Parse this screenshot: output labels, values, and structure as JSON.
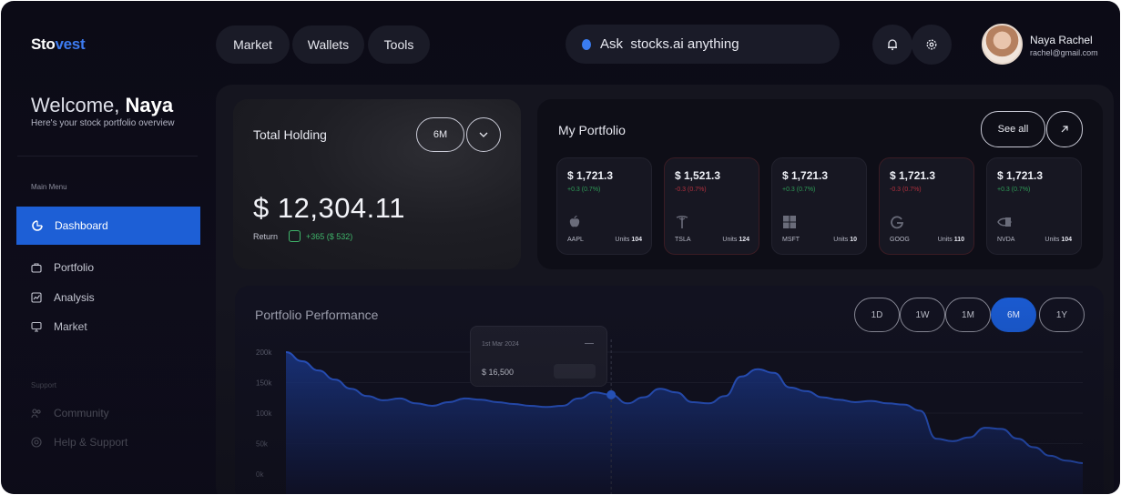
{
  "brand": {
    "name_part1": "Sto",
    "name_part2": "vest"
  },
  "nav": {
    "items": [
      "Market",
      "Wallets",
      "Tools"
    ]
  },
  "search": {
    "placeholder": "Ask  stocks.ai anything"
  },
  "header_icons": [
    "bell-icon",
    "gear-icon"
  ],
  "user": {
    "name": "Naya Rachel",
    "email": "rachel@gmail.com"
  },
  "sidebar": {
    "welcome_prefix": "Welcome, ",
    "welcome_name": "Naya",
    "subtitle": "Here's your stock portfolio overview",
    "main_menu_label": "Main Menu",
    "menu": [
      {
        "label": "Dashboard",
        "icon": "dashboard-icon",
        "active": true
      },
      {
        "label": "Portfolio",
        "icon": "portfolio-icon",
        "active": false
      },
      {
        "label": "Analysis",
        "icon": "analysis-icon",
        "active": false
      },
      {
        "label": "Market",
        "icon": "market-icon",
        "active": false
      }
    ],
    "support_label": "Support",
    "support": [
      {
        "label": "Community",
        "icon": "community-icon"
      },
      {
        "label": "Help & Support",
        "icon": "help-icon"
      }
    ]
  },
  "holding": {
    "title": "Total Holding",
    "period": "6M",
    "value": "$ 12,304.11",
    "return_label": "Return",
    "return_value": "+365 ($ 532)"
  },
  "portfolio": {
    "title": "My Portfolio",
    "see_all": "See all",
    "stocks": [
      {
        "price": "$ 1,721.3",
        "change": "+0.3 (0.7%)",
        "direction": "up",
        "symbol": "AAPL",
        "units_label": "Units",
        "units": "104",
        "icon": "apple-icon"
      },
      {
        "price": "$ 1,521.3",
        "change": "-0.3 (0.7%)",
        "direction": "down",
        "symbol": "TSLA",
        "units_label": "Units",
        "units": "124",
        "icon": "tesla-icon"
      },
      {
        "price": "$ 1,721.3",
        "change": "+0.3 (0.7%)",
        "direction": "up",
        "symbol": "MSFT",
        "units_label": "Units",
        "units": "10",
        "icon": "microsoft-icon"
      },
      {
        "price": "$ 1,721.3",
        "change": "-0.3 (0.7%)",
        "direction": "down",
        "symbol": "GOOG",
        "units_label": "Units",
        "units": "110",
        "icon": "google-icon"
      },
      {
        "price": "$ 1,721.3",
        "change": "+0.3 (0.7%)",
        "direction": "up",
        "symbol": "NVDA",
        "units_label": "Units",
        "units": "104",
        "icon": "nvidia-icon"
      }
    ],
    "colors": {
      "up": "#2e9c57",
      "down": "#b3303e"
    }
  },
  "performance": {
    "title": "Portfolio Performance",
    "ranges": [
      "1D",
      "1W",
      "1M",
      "6M",
      "1Y"
    ],
    "active_range": "6M",
    "tooltip": {
      "date": "1st Mar 2024",
      "value": "$ 16,500"
    },
    "accent": "#1a5ad0"
  },
  "chart_data": {
    "type": "area",
    "y_ticks": [
      "200k",
      "150k",
      "100k",
      "50k",
      "0k"
    ],
    "ylim": [
      0,
      200000
    ],
    "values": [
      200000,
      185000,
      170000,
      155000,
      140000,
      128000,
      121000,
      124000,
      116000,
      112000,
      118000,
      124000,
      122000,
      118000,
      115000,
      112000,
      110000,
      112000,
      124000,
      134000,
      130000,
      116000,
      126000,
      140000,
      134000,
      118000,
      116000,
      128000,
      160000,
      172000,
      166000,
      142000,
      136000,
      126000,
      122000,
      118000,
      120000,
      116000,
      114000,
      104000,
      58000,
      54000,
      60000,
      76000,
      74000,
      58000,
      44000,
      30000,
      22000,
      18000
    ],
    "highlight_index": 20,
    "grid": true
  }
}
